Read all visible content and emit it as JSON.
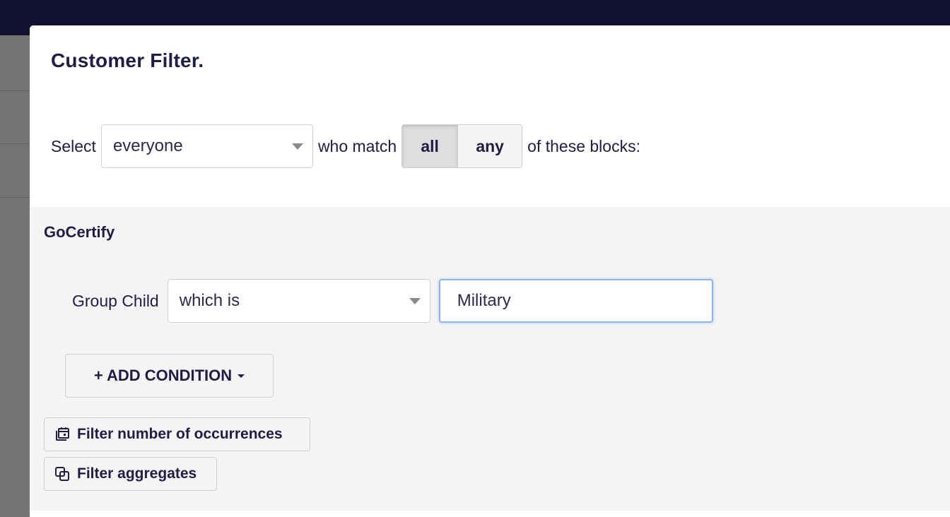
{
  "modal": {
    "title": "Customer Filter."
  },
  "selector": {
    "prefix": "Select",
    "audience_value": "everyone",
    "match_text": "who match",
    "match_options": [
      "all",
      "any"
    ],
    "match_selected": "all",
    "suffix": "of these blocks:"
  },
  "block": {
    "title": "GoCertify",
    "condition": {
      "field_label": "Group Child",
      "operator_value": "which is",
      "value": "Military"
    },
    "add_condition_label": "+ ADD CONDITION",
    "filter_occurrences_label": "Filter number of occurrences",
    "filter_aggregates_label": "Filter aggregates"
  },
  "icons": {
    "dropdown": "chevron-down-icon",
    "occurrences": "calendar-stack-icon",
    "aggregates": "copy-squares-icon"
  },
  "colors": {
    "topbar": "#12112f",
    "text": "#1f1d44",
    "block_bg": "#f4f4f4",
    "input_focus": "#8db4f2"
  }
}
